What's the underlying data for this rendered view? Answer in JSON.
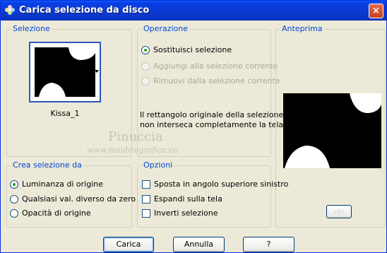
{
  "window": {
    "title": "Carica selezione da disco",
    "close_label": "×",
    "app_icon": "flower-icon"
  },
  "selezione": {
    "title": "Selezione",
    "preset_name": "Kissa_1"
  },
  "operazione": {
    "title": "Operazione",
    "options": [
      {
        "label": "Sostituisci selezione",
        "checked": true,
        "enabled": true
      },
      {
        "label": "Aggiungi alla selezione corrente",
        "checked": false,
        "enabled": false
      },
      {
        "label": "Rimuovi dalla selezione corrente",
        "checked": false,
        "enabled": false
      }
    ],
    "note_line1": "Il rettangolo originale della selezione",
    "note_line2": "non interseca completamente la tela."
  },
  "anteprima": {
    "title": "Anteprima",
    "toggle_icon": "preview-toggle-icon"
  },
  "crea": {
    "title": "Crea selezione da",
    "options": [
      {
        "label": "Luminanza di origine",
        "checked": true
      },
      {
        "label": "Qualsiasi val. diverso da zero",
        "checked": false
      },
      {
        "label": "Opacità di origine",
        "checked": false
      }
    ]
  },
  "opzioni": {
    "title": "Opzioni",
    "checks": [
      {
        "label": "Sposta in angolo superiore sinistro",
        "checked": false
      },
      {
        "label": "Espandi sulla tela",
        "checked": false
      },
      {
        "label": "Inverti selezione",
        "checked": false
      }
    ]
  },
  "buttons": {
    "load": "Carica",
    "cancel": "Annulla",
    "help": "?"
  },
  "watermark": {
    "name": "Pinuccia",
    "site": "www.maidiregrafica.eu"
  }
}
